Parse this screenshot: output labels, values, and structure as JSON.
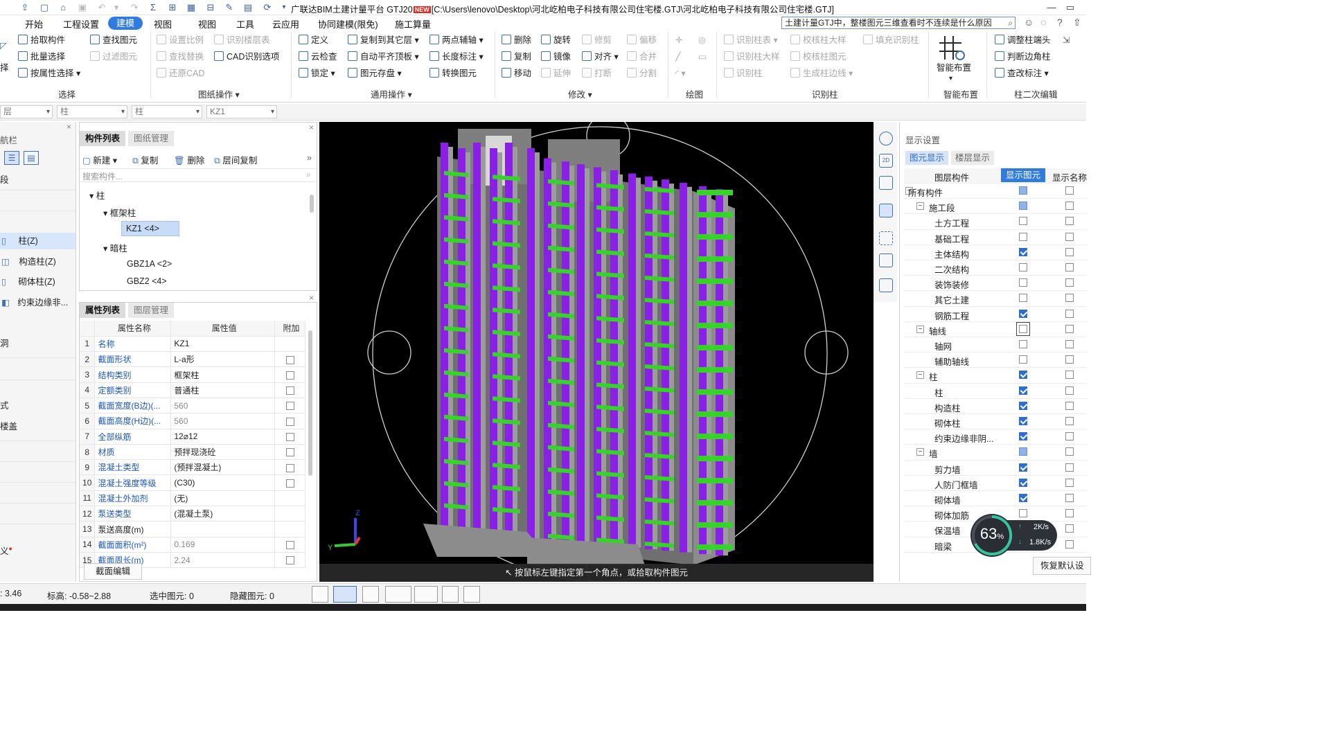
{
  "title": {
    "prefix": "广联达BIM土建计量平台 GTJ20",
    "badge": "NEW",
    "path": "[C:\\Users\\lenovo\\Desktop\\河北屹柏电子科技有限公司住宅楼.GTJ\\河北屹柏电子科技有限公司住宅楼.GTJ]"
  },
  "search": {
    "value": "土建计量GTJ中，整楼图元三维查看时不连续是什么原因"
  },
  "menu": [
    "开始",
    "工程设置",
    "建模",
    "视图",
    "工具",
    "云应用",
    "协同建模(限免)",
    "施工算量"
  ],
  "menu_active": "建模",
  "ribbon": {
    "select": {
      "items": [
        "拾取构件",
        "批量选择",
        "按属性选择"
      ],
      "group": "选择"
    },
    "find": {
      "items": [
        "查找图元",
        "过滤图元"
      ]
    },
    "drawing": {
      "items": [
        "设置比例",
        "识别楼层表",
        "查找替换",
        "CAD识别选项",
        "还原CAD"
      ],
      "group": "图纸操作"
    },
    "common": {
      "items": [
        "定义",
        "复制到其它层",
        "两点辅轴",
        "云检查",
        "自动平齐顶板",
        "长度标注",
        "锁定",
        "图元存盘",
        "转换图元"
      ],
      "group": "通用操作"
    },
    "modify": {
      "items": [
        "删除",
        "旋转",
        "修剪",
        "偏移",
        "复制",
        "镜像",
        "对齐",
        "合并",
        "移动",
        "延伸",
        "打断",
        "分割"
      ],
      "group": "修改"
    },
    "draw": {
      "group": "绘图"
    },
    "identify": {
      "items": [
        "识别柱表",
        "校核柱大样",
        "填充识别柱",
        "识别柱大样",
        "校核柱图元",
        "识别柱",
        "生成柱边线"
      ],
      "group": "识别柱"
    },
    "smart": {
      "items": [
        "智能布置"
      ],
      "group": "智能布置"
    },
    "secondary": {
      "items": [
        "调整柱端头",
        "判断边角柱",
        "查改标注"
      ],
      "group": "柱二次编辑"
    }
  },
  "propbar": {
    "combos": [
      "层",
      "柱",
      "柱",
      "KZ1"
    ]
  },
  "leftnav": {
    "header": "航栏",
    "items": [
      "段",
      "柱(Z)",
      "构造柱(Z)",
      "砌体柱(Z)",
      "约束边缘非...",
      "洞",
      "式",
      "楼盖",
      "义"
    ]
  },
  "component_panel": {
    "tabs": [
      "构件列表",
      "图纸管理"
    ],
    "tools": [
      "新建",
      "复制",
      "删除",
      "层间复制"
    ],
    "search_placeholder": "搜索构件...",
    "tree": {
      "root": "柱",
      "group1": "框架柱",
      "item1": "KZ1 <4>",
      "group2": "暗柱",
      "item2": "GBZ1A <2>",
      "item3": "GBZ2 <4>"
    }
  },
  "property_panel": {
    "tabs": [
      "属性列表",
      "图层管理"
    ],
    "headers": [
      "属性名称",
      "属性值",
      "附加"
    ],
    "rows": [
      {
        "n": "1",
        "name": "名称",
        "value": "KZ1",
        "check": false
      },
      {
        "n": "2",
        "name": "截面形状",
        "value": "L-a形",
        "check": true
      },
      {
        "n": "3",
        "name": "结构类别",
        "value": "框架柱",
        "check": true
      },
      {
        "n": "4",
        "name": "定额类别",
        "value": "普通柱",
        "check": true
      },
      {
        "n": "5",
        "name": "截面宽度(B边)(...",
        "value": "560",
        "check": true
      },
      {
        "n": "6",
        "name": "截面高度(H边)(...",
        "value": "560",
        "check": true
      },
      {
        "n": "7",
        "name": "全部纵筋",
        "value": "12⌀12",
        "check": true
      },
      {
        "n": "8",
        "name": "材质",
        "value": "预拌现浇砼",
        "check": true
      },
      {
        "n": "9",
        "name": "混凝土类型",
        "value": "(预拌混凝土)",
        "check": true
      },
      {
        "n": "10",
        "name": "混凝土强度等级",
        "value": "(C30)",
        "check": true
      },
      {
        "n": "11",
        "name": "混凝土外加剂",
        "value": "(无)",
        "check": false
      },
      {
        "n": "12",
        "name": "泵送类型",
        "value": "(混凝土泵)",
        "check": false
      },
      {
        "n": "13",
        "name": "泵送高度(m)",
        "value": "",
        "check": false
      },
      {
        "n": "14",
        "name": "截面面积(m²)",
        "value": "0.169",
        "check": true
      },
      {
        "n": "15",
        "name": "截面周长(m)",
        "value": "2.24",
        "check": true
      }
    ],
    "edit_button": "截面编辑"
  },
  "viewport": {
    "hint": "按鼠标左键指定第一个角点，或拾取构件图元"
  },
  "display_panel": {
    "title": "显示设置",
    "tabs": [
      "图元显示",
      "楼层显示"
    ],
    "headers": [
      "图层构件",
      "显示图元",
      "显示名称"
    ],
    "rows": [
      {
        "label": "所有构件",
        "level": 0,
        "pm": "−",
        "show": "half",
        "name": false
      },
      {
        "label": "施工段",
        "level": 1,
        "pm": "−",
        "show": "half",
        "name": false
      },
      {
        "label": "土方工程",
        "level": 2,
        "pm": "",
        "show": "off",
        "name": false
      },
      {
        "label": "基础工程",
        "level": 2,
        "pm": "",
        "show": "off",
        "name": false
      },
      {
        "label": "主体结构",
        "level": 2,
        "pm": "",
        "show": "on",
        "name": false
      },
      {
        "label": "二次结构",
        "level": 2,
        "pm": "",
        "show": "off",
        "name": false
      },
      {
        "label": "装饰装修",
        "level": 2,
        "pm": "",
        "show": "off",
        "name": false
      },
      {
        "label": "其它土建",
        "level": 2,
        "pm": "",
        "show": "off",
        "name": false
      },
      {
        "label": "钢筋工程",
        "level": 2,
        "pm": "",
        "show": "on",
        "name": false
      },
      {
        "label": "轴线",
        "level": 1,
        "pm": "−",
        "show": "off",
        "name": false
      },
      {
        "label": "轴网",
        "level": 2,
        "pm": "",
        "show": "off",
        "name": false
      },
      {
        "label": "辅助轴线",
        "level": 2,
        "pm": "",
        "show": "off",
        "name": false
      },
      {
        "label": "柱",
        "level": 1,
        "pm": "−",
        "show": "on",
        "name": false
      },
      {
        "label": "柱",
        "level": 2,
        "pm": "",
        "show": "on",
        "name": false
      },
      {
        "label": "构造柱",
        "level": 2,
        "pm": "",
        "show": "on",
        "name": false
      },
      {
        "label": "砌体柱",
        "level": 2,
        "pm": "",
        "show": "on",
        "name": false
      },
      {
        "label": "约束边缘非阴...",
        "level": 2,
        "pm": "",
        "show": "on",
        "name": false
      },
      {
        "label": "墙",
        "level": 1,
        "pm": "−",
        "show": "half",
        "name": false
      },
      {
        "label": "剪力墙",
        "level": 2,
        "pm": "",
        "show": "on",
        "name": false
      },
      {
        "label": "人防门框墙",
        "level": 2,
        "pm": "",
        "show": "on",
        "name": false
      },
      {
        "label": "砌体墙",
        "level": 2,
        "pm": "",
        "show": "on",
        "name": false
      },
      {
        "label": "砌体加筋",
        "level": 2,
        "pm": "",
        "show": "off",
        "name": false
      },
      {
        "label": "保温墙",
        "level": 2,
        "pm": "",
        "show": "off",
        "name": false
      },
      {
        "label": "暗梁",
        "level": 2,
        "pm": "",
        "show": "off",
        "name": false
      }
    ],
    "restore_button": "恢复默认设"
  },
  "speed": {
    "percent": "63",
    "unit": "%",
    "up": "2K/s",
    "down": "1.8K/s"
  },
  "status": {
    "coord": ": 3.46",
    "elev": "标高: -0.58~2.88",
    "selected": "选中图元: 0",
    "hidden": "隐藏图元: 0"
  },
  "colors": {
    "accent": "#2f7be0",
    "wall": "#8a1fe8",
    "slab": "#39d12b",
    "column": "#9c9c9c",
    "viewport_bg": "#000000"
  }
}
